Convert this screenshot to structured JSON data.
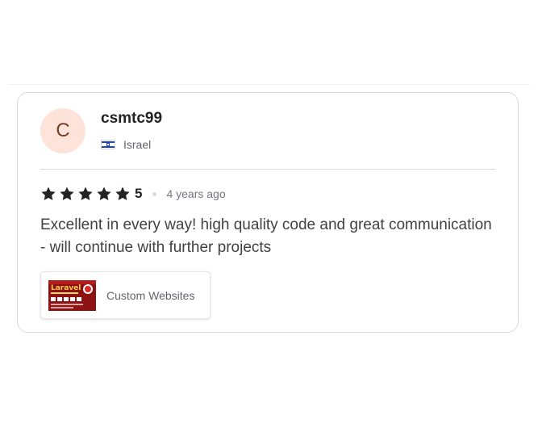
{
  "review": {
    "avatar_initial": "C",
    "username": "csmtc99",
    "country": "Israel",
    "flag_icon": "israel-flag-icon",
    "rating": {
      "stars": 5,
      "value_label": "5",
      "star_color": "#222325"
    },
    "time_ago": "4 years ago",
    "text": "Excellent in every way! high quality code and great communication - will continue with further projects",
    "gig": {
      "title": "Custom Websites",
      "thumbnail_text": "Laravel"
    }
  },
  "colors": {
    "avatar_bg": "#fde3d9",
    "avatar_text": "#7a3b26",
    "border": "#dadbdd"
  }
}
